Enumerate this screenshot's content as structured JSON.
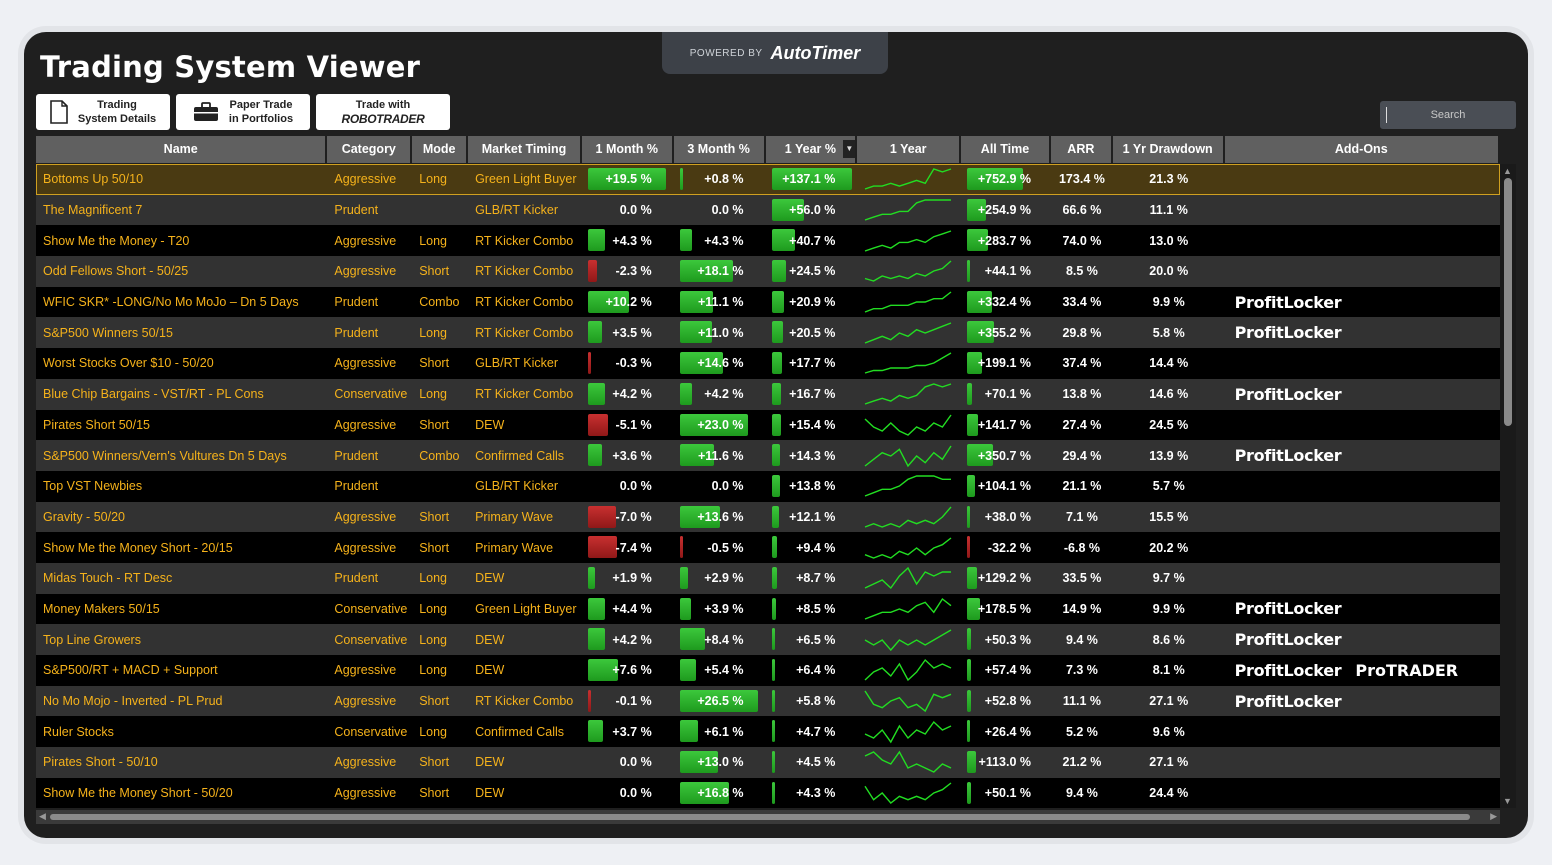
{
  "window": {
    "title": "Trading System Viewer",
    "powered_by": "POWERED BY",
    "brand": "AutoTimer"
  },
  "toolbar": {
    "details_label_1": "Trading",
    "details_label_2": "System Details",
    "paper_label_1": "Paper Trade",
    "paper_label_2": "in Portfolios",
    "trade_label": "Trade with",
    "robo_label": "ROBOTRADER"
  },
  "search": {
    "placeholder": "Search"
  },
  "columns": {
    "name": "Name",
    "category": "Category",
    "mode": "Mode",
    "market_timing": "Market Timing",
    "m1": "1 Month %",
    "m3": "3 Month %",
    "y1": "1 Year %",
    "y1_chart": "1 Year",
    "all_time": "All Time",
    "arr": "ARR",
    "drawdown": "1 Yr Drawdown",
    "addons": "Add-Ons"
  },
  "colors": {
    "accent_text": "#f5b21b",
    "positive_bar": "#2eb82e",
    "negative_bar": "#b42424",
    "sparkline": "#22dd22"
  },
  "addon_labels": {
    "profit_locker": "ProfitLocker",
    "pro_trader": "ProTRADER"
  },
  "rows": [
    {
      "name": "Bottoms Up 50/10",
      "category": "Aggressive",
      "mode": "Long",
      "timing": "Green Light Buyer",
      "m1": "+19.5 %",
      "m1v": 19.5,
      "m3": "+0.8 %",
      "m3v": 0.8,
      "y1": "+137.1 %",
      "y1v": 137.1,
      "all": "+752.9 %",
      "allv": 752.9,
      "arr": "173.4 %",
      "dd": "21.3 %",
      "addons": [],
      "spark": [
        2,
        3,
        3,
        4,
        3,
        4,
        5,
        4,
        9,
        8,
        9
      ],
      "selected": true
    },
    {
      "name": "The Magnificent 7",
      "category": "Prudent",
      "mode": "",
      "timing": "GLB/RT Kicker",
      "m1": "0.0 %",
      "m1v": 0,
      "m3": "0.0 %",
      "m3v": 0,
      "y1": "+56.0 %",
      "y1v": 56.0,
      "all": "+254.9 %",
      "allv": 254.9,
      "arr": "66.6 %",
      "dd": "11.1 %",
      "addons": [],
      "spark": [
        1,
        2,
        3,
        3,
        4,
        4,
        7,
        8,
        8,
        8,
        8
      ]
    },
    {
      "name": "Show Me the Money - T20",
      "category": "Aggressive",
      "mode": "Long",
      "timing": "RT Kicker Combo",
      "m1": "+4.3 %",
      "m1v": 4.3,
      "m3": "+4.3 %",
      "m3v": 4.3,
      "y1": "+40.7 %",
      "y1v": 40.7,
      "all": "+283.7 %",
      "allv": 283.7,
      "arr": "74.0 %",
      "dd": "13.0 %",
      "addons": [],
      "spark": [
        1,
        2,
        3,
        2,
        4,
        4,
        5,
        4,
        6,
        7,
        8
      ]
    },
    {
      "name": "Odd Fellows Short - 50/25",
      "category": "Aggressive",
      "mode": "Short",
      "timing": "RT Kicker Combo",
      "m1": "-2.3 %",
      "m1v": -2.3,
      "m3": "+18.1 %",
      "m3v": 18.1,
      "y1": "+24.5 %",
      "y1v": 24.5,
      "all": "+44.1 %",
      "allv": 44.1,
      "arr": "8.5 %",
      "dd": "20.0 %",
      "addons": [],
      "spark": [
        2,
        1,
        3,
        2,
        3,
        2,
        4,
        3,
        5,
        6,
        9
      ]
    },
    {
      "name": "WFIC SKR* -LONG/No Mo MoJo – Dn 5 Days",
      "category": "Prudent",
      "mode": "Combo",
      "timing": "RT Kicker Combo",
      "m1": "+10.2 %",
      "m1v": 10.2,
      "m3": "+11.1 %",
      "m3v": 11.1,
      "y1": "+20.9 %",
      "y1v": 20.9,
      "all": "+332.4 %",
      "allv": 332.4,
      "arr": "33.4 %",
      "dd": "9.9 %",
      "addons": [
        "profit_locker"
      ],
      "spark": [
        2,
        3,
        3,
        4,
        4,
        4,
        5,
        5,
        6,
        6,
        8
      ]
    },
    {
      "name": "S&P500 Winners 50/15",
      "category": "Prudent",
      "mode": "Long",
      "timing": "RT Kicker Combo",
      "m1": "+3.5 %",
      "m1v": 3.5,
      "m3": "+11.0 %",
      "m3v": 11.0,
      "y1": "+20.5 %",
      "y1v": 20.5,
      "all": "+355.2 %",
      "allv": 355.2,
      "arr": "29.8 %",
      "dd": "5.8 %",
      "addons": [
        "profit_locker"
      ],
      "spark": [
        2,
        3,
        4,
        3,
        5,
        4,
        6,
        5,
        6,
        7,
        8
      ]
    },
    {
      "name": "Worst Stocks Over $10 - 50/20",
      "category": "Aggressive",
      "mode": "Short",
      "timing": "GLB/RT Kicker",
      "m1": "-0.3 %",
      "m1v": -0.3,
      "m3": "+14.6 %",
      "m3v": 14.6,
      "y1": "+17.7 %",
      "y1v": 17.7,
      "all": "+199.1 %",
      "allv": 199.1,
      "arr": "37.4 %",
      "dd": "14.4 %",
      "addons": [],
      "spark": [
        1,
        2,
        2,
        3,
        3,
        3,
        4,
        4,
        5,
        7,
        9
      ]
    },
    {
      "name": "Blue Chip Bargains - VST/RT - PL Cons",
      "category": "Conservative",
      "mode": "Long",
      "timing": "RT Kicker Combo",
      "m1": "+4.2 %",
      "m1v": 4.2,
      "m3": "+4.2 %",
      "m3v": 4.2,
      "y1": "+16.7 %",
      "y1v": 16.7,
      "all": "+70.1 %",
      "allv": 70.1,
      "arr": "13.8 %",
      "dd": "14.6 %",
      "addons": [
        "profit_locker"
      ],
      "spark": [
        1,
        2,
        3,
        2,
        4,
        3,
        4,
        7,
        8,
        7,
        8
      ]
    },
    {
      "name": "Pirates Short 50/15",
      "category": "Aggressive",
      "mode": "Short",
      "timing": "DEW",
      "m1": "-5.1 %",
      "m1v": -5.1,
      "m3": "+23.0 %",
      "m3v": 23.0,
      "y1": "+15.4 %",
      "y1v": 15.4,
      "all": "+141.7 %",
      "allv": 141.7,
      "arr": "27.4 %",
      "dd": "24.5 %",
      "addons": [],
      "spark": [
        6,
        4,
        3,
        5,
        3,
        2,
        4,
        3,
        5,
        4,
        7
      ]
    },
    {
      "name": "S&P500 Winners/Vern's Vultures Dn 5 Days",
      "category": "Prudent",
      "mode": "Combo",
      "timing": "Confirmed Calls",
      "m1": "+3.6 %",
      "m1v": 3.6,
      "m3": "+11.6 %",
      "m3v": 11.6,
      "y1": "+14.3 %",
      "y1v": 14.3,
      "all": "+350.7 %",
      "allv": 350.7,
      "arr": "29.4 %",
      "dd": "13.9 %",
      "addons": [
        "profit_locker"
      ],
      "spark": [
        2,
        4,
        6,
        5,
        7,
        2,
        5,
        3,
        6,
        4,
        8
      ]
    },
    {
      "name": "Top VST Newbies",
      "category": "Prudent",
      "mode": "",
      "timing": "GLB/RT Kicker",
      "m1": "0.0 %",
      "m1v": 0,
      "m3": "0.0 %",
      "m3v": 0,
      "y1": "+13.8 %",
      "y1v": 13.8,
      "all": "+104.1 %",
      "allv": 104.1,
      "arr": "21.1 %",
      "dd": "5.7 %",
      "addons": [],
      "spark": [
        1,
        2,
        3,
        3,
        4,
        6,
        7,
        7,
        7,
        6,
        6
      ]
    },
    {
      "name": "Gravity - 50/20",
      "category": "Aggressive",
      "mode": "Short",
      "timing": "Primary Wave",
      "m1": "-7.0 %",
      "m1v": -7.0,
      "m3": "+13.6 %",
      "m3v": 13.6,
      "y1": "+12.1 %",
      "y1v": 12.1,
      "all": "+38.0 %",
      "allv": 38.0,
      "arr": "7.1 %",
      "dd": "15.5 %",
      "addons": [],
      "spark": [
        2,
        3,
        2,
        3,
        2,
        4,
        3,
        4,
        3,
        5,
        8
      ]
    },
    {
      "name": "Show Me the Money Short - 20/15",
      "category": "Aggressive",
      "mode": "Short",
      "timing": "Primary Wave",
      "m1": "-7.4 %",
      "m1v": -7.4,
      "m3": "-0.5 %",
      "m3v": -0.5,
      "y1": "+9.4 %",
      "y1v": 9.4,
      "all": "-32.2 %",
      "allv": -32.2,
      "arr": "-6.8 %",
      "dd": "20.2 %",
      "addons": [],
      "spark": [
        3,
        2,
        3,
        2,
        4,
        3,
        5,
        3,
        5,
        6,
        8
      ]
    },
    {
      "name": "Midas Touch - RT Desc",
      "category": "Prudent",
      "mode": "Long",
      "timing": "DEW",
      "m1": "+1.9 %",
      "m1v": 1.9,
      "m3": "+2.9 %",
      "m3v": 2.9,
      "y1": "+8.7 %",
      "y1v": 8.7,
      "all": "+129.2 %",
      "allv": 129.2,
      "arr": "33.5 %",
      "dd": "9.7 %",
      "addons": [],
      "spark": [
        2,
        3,
        4,
        2,
        5,
        7,
        3,
        6,
        5,
        6,
        6
      ]
    },
    {
      "name": "Money Makers 50/15",
      "category": "Conservative",
      "mode": "Long",
      "timing": "Green Light Buyer",
      "m1": "+4.4 %",
      "m1v": 4.4,
      "m3": "+3.9 %",
      "m3v": 3.9,
      "y1": "+8.5 %",
      "y1v": 8.5,
      "all": "+178.5 %",
      "allv": 178.5,
      "arr": "14.9 %",
      "dd": "9.9 %",
      "addons": [
        "profit_locker"
      ],
      "spark": [
        2,
        3,
        4,
        4,
        5,
        4,
        6,
        7,
        4,
        8,
        6
      ]
    },
    {
      "name": "Top Line Growers",
      "category": "Conservative",
      "mode": "Long",
      "timing": "DEW",
      "m1": "+4.2 %",
      "m1v": 4.2,
      "m3": "+8.4 %",
      "m3v": 8.4,
      "y1": "+6.5 %",
      "y1v": 6.5,
      "all": "+50.3 %",
      "allv": 50.3,
      "arr": "9.4 %",
      "dd": "8.6 %",
      "addons": [
        "profit_locker"
      ],
      "spark": [
        4,
        3,
        4,
        2,
        4,
        3,
        4,
        3,
        4,
        5,
        6
      ]
    },
    {
      "name": "S&P500/RT + MACD + Support",
      "category": "Aggressive",
      "mode": "Long",
      "timing": "DEW",
      "m1": "+7.6 %",
      "m1v": 7.6,
      "m3": "+5.4 %",
      "m3v": 5.4,
      "y1": "+6.4 %",
      "y1v": 6.4,
      "all": "+57.4 %",
      "allv": 57.4,
      "arr": "7.3 %",
      "dd": "8.1 %",
      "addons": [
        "profit_locker",
        "pro_trader"
      ],
      "spark": [
        2,
        4,
        5,
        3,
        6,
        2,
        4,
        7,
        5,
        6,
        5
      ]
    },
    {
      "name": "No Mo Mojo - Inverted - PL Prud",
      "category": "Aggressive",
      "mode": "Short",
      "timing": "RT Kicker Combo",
      "m1": "-0.1 %",
      "m1v": -0.1,
      "m3": "+26.5 %",
      "m3v": 26.5,
      "y1": "+5.8 %",
      "y1v": 5.8,
      "all": "+52.8 %",
      "allv": 52.8,
      "arr": "11.1 %",
      "dd": "27.1 %",
      "addons": [
        "profit_locker"
      ],
      "spark": [
        8,
        4,
        3,
        5,
        6,
        3,
        4,
        2,
        7,
        6,
        7
      ]
    },
    {
      "name": "Ruler Stocks",
      "category": "Conservative",
      "mode": "Long",
      "timing": "Confirmed Calls",
      "m1": "+3.7 %",
      "m1v": 3.7,
      "m3": "+6.1 %",
      "m3v": 6.1,
      "y1": "+4.7 %",
      "y1v": 4.7,
      "all": "+26.4 %",
      "allv": 26.4,
      "arr": "5.2 %",
      "dd": "9.6 %",
      "addons": [],
      "spark": [
        4,
        3,
        5,
        2,
        6,
        3,
        5,
        4,
        7,
        5,
        6
      ]
    },
    {
      "name": "Pirates Short - 50/10",
      "category": "Aggressive",
      "mode": "Short",
      "timing": "DEW",
      "m1": "0.0 %",
      "m1v": 0,
      "m3": "+13.0 %",
      "m3v": 13.0,
      "y1": "+4.5 %",
      "y1v": 4.5,
      "all": "+113.0 %",
      "allv": 113.0,
      "arr": "21.2 %",
      "dd": "27.1 %",
      "addons": [],
      "spark": [
        6,
        7,
        5,
        4,
        7,
        3,
        4,
        3,
        2,
        4,
        3
      ]
    },
    {
      "name": "Show Me the Money Short - 50/20",
      "category": "Aggressive",
      "mode": "Short",
      "timing": "DEW",
      "m1": "0.0 %",
      "m1v": 0,
      "m3": "+16.8 %",
      "m3v": 16.8,
      "y1": "+4.3 %",
      "y1v": 4.3,
      "all": "+50.1 %",
      "allv": 50.1,
      "arr": "9.4 %",
      "dd": "24.4 %",
      "addons": [],
      "spark": [
        7,
        3,
        5,
        2,
        4,
        3,
        4,
        3,
        5,
        6,
        8
      ]
    }
  ]
}
